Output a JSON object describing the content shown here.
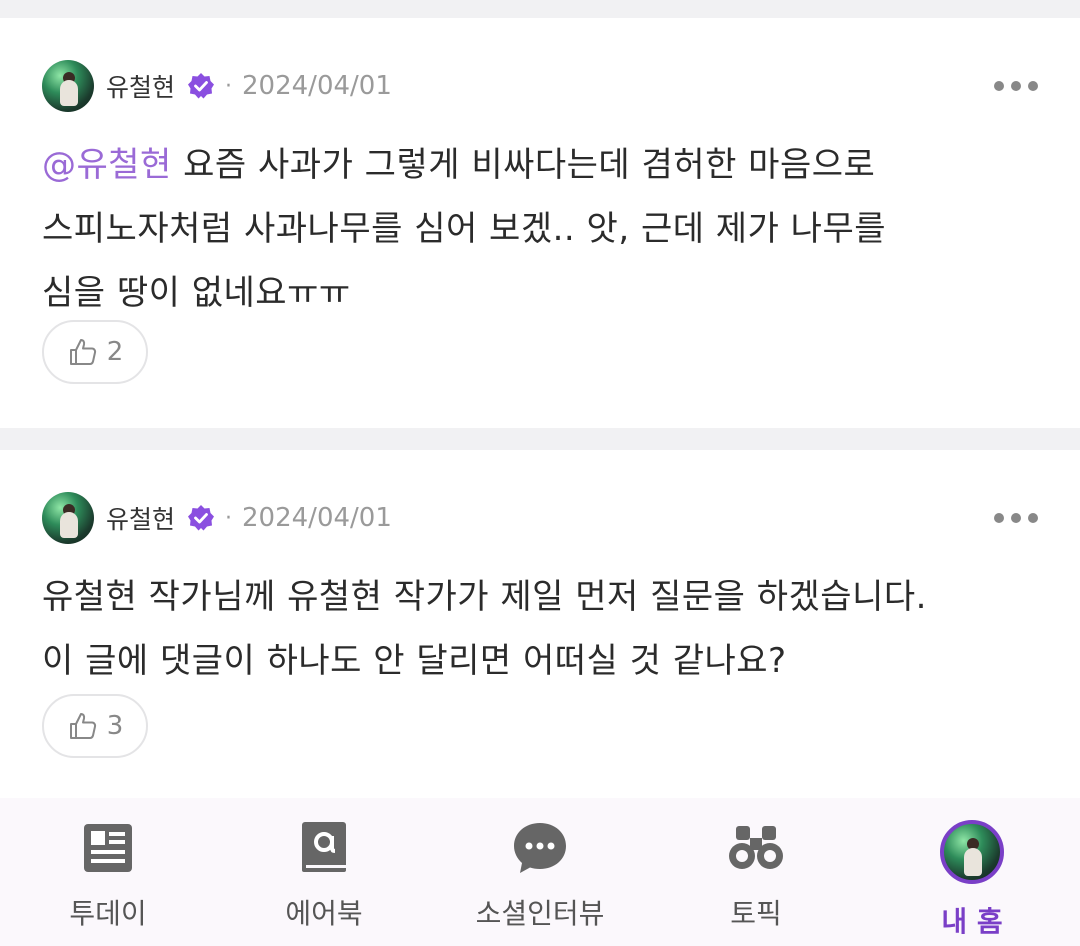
{
  "posts": [
    {
      "author": "유철현",
      "separator": "·",
      "date": "2024/04/01",
      "mention": "@유철현",
      "text_line1_rest": " 요즘 사과가 그렇게 비싸다는데 겸허한 마음으로",
      "text_line2": "스피노자처럼 사과나무를 심어 보겠.. 앗, 근데 제가 나무를",
      "text_line3": "심을 땅이 없네요ㅠㅠ",
      "likes": "2"
    },
    {
      "author": "유철현",
      "separator": "·",
      "date": "2024/04/01",
      "text_line1": "유철현 작가님께 유철현 작가가 제일 먼저 질문을 하겠습니다.",
      "text_line2": "이 글에 댓글이 하나도 안 달리면 어떠실 것 같나요?",
      "likes": "3"
    }
  ],
  "nav": {
    "items": [
      {
        "label": "투데이",
        "icon": "newspaper-icon"
      },
      {
        "label": "에어북",
        "icon": "book-icon"
      },
      {
        "label": "소셜인터뷰",
        "icon": "chat-bubble-icon"
      },
      {
        "label": "토픽",
        "icon": "binoculars-icon"
      },
      {
        "label": "내 홈",
        "icon": "profile-avatar"
      }
    ],
    "active_index": 4
  },
  "colors": {
    "accent": "#7a3fc7",
    "mention": "#9a6ad6",
    "verified": "#8a4fe0"
  }
}
